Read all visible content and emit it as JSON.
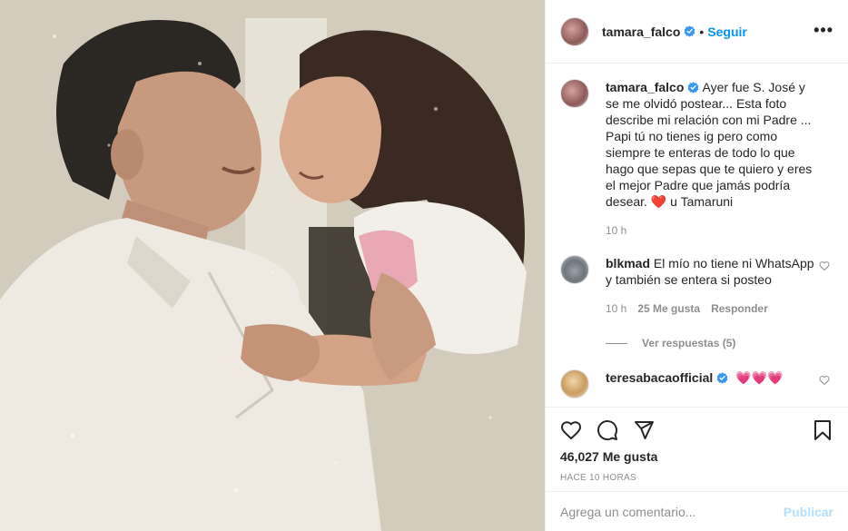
{
  "photo": {
    "alt": ""
  },
  "header": {
    "username": "tamara_falco",
    "separator": "•",
    "follow_label": "Seguir",
    "more_label": "•••"
  },
  "caption": {
    "username": "tamara_falco",
    "text": "Ayer fue S. José y se me olvidó postear... Esta foto describe mi relación con mi Padre ... Papi tú no tienes ig pero como siempre te enteras de todo lo que hago que sepas que te quiero y eres el mejor Padre que jamás podría desear.",
    "emoji": "❤️",
    "signoff": "u Tamaruni",
    "time": "10 h"
  },
  "comments": [
    {
      "username": "blkmad",
      "text": "El mío no tiene ni WhatsApp y también se entera si posteo",
      "time": "10 h",
      "likes": "25 Me gusta",
      "reply_label": "Responder",
      "view_replies": "Ver respuestas (5)"
    },
    {
      "username": "teresabacaofficial",
      "text": "💗💗💗"
    }
  ],
  "stats": {
    "likes": "46,027 Me gusta",
    "posted": "HACE 10 HORAS"
  },
  "compose": {
    "placeholder": "Agrega un comentario...",
    "publish_label": "Publicar"
  },
  "icons": {
    "like": "heart-icon",
    "comment": "comment-icon",
    "share": "share-icon",
    "save": "bookmark-icon",
    "verified": "verified-badge-icon"
  },
  "colors": {
    "link": "#0095f6",
    "verified": "#3897f0",
    "muted": "#8e8e8e",
    "publish_disabled": "#b2dffc"
  }
}
